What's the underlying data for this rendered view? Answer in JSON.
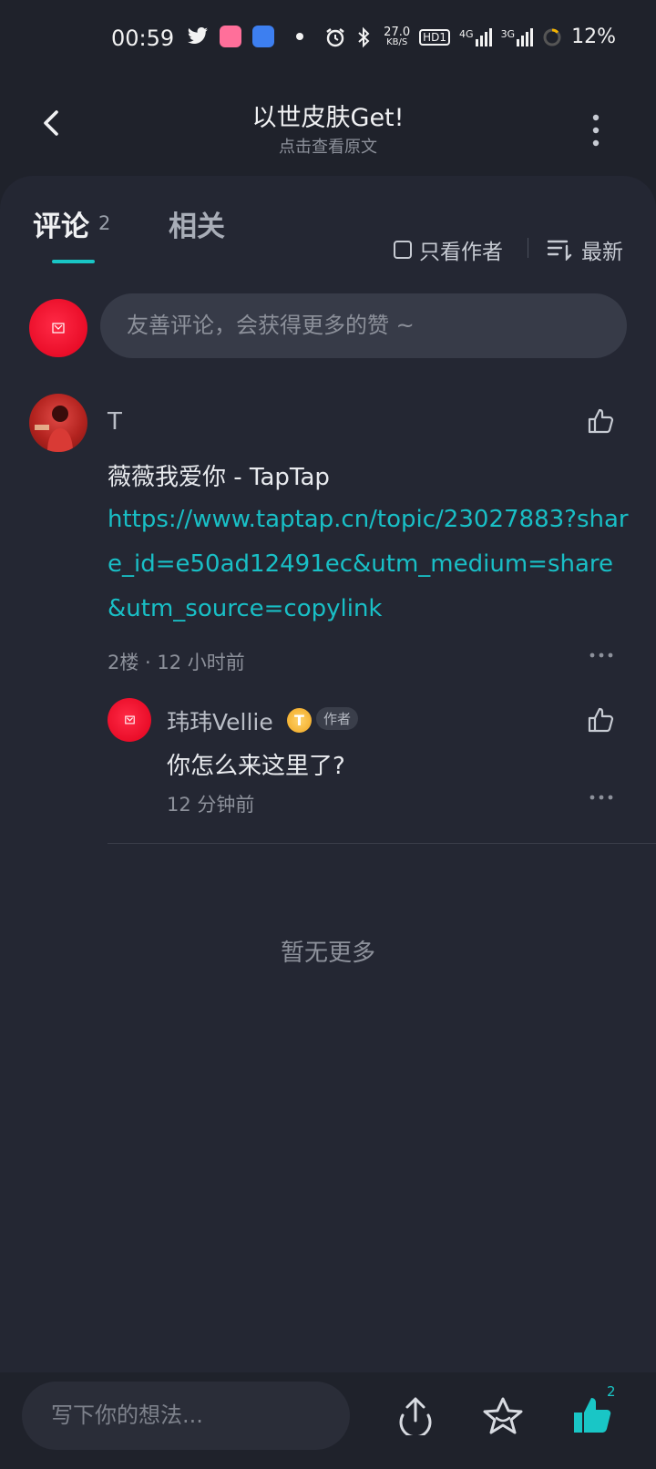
{
  "status_bar": {
    "time": "00:59",
    "net_speed_value": "27.0",
    "net_speed_unit": "KB/S",
    "hd": "HD1",
    "net1": "4G",
    "net2": "3G",
    "battery": "12%"
  },
  "header": {
    "title": "以世皮肤Get!",
    "subtitle": "点击查看原文"
  },
  "tabs": {
    "comments_label": "评论",
    "comments_count": "2",
    "related_label": "相关",
    "author_only_label": "只看作者",
    "sort_label": "最新"
  },
  "composer": {
    "placeholder": "友善评论，会获得更多的赞 ~"
  },
  "comment": {
    "author": "T",
    "text": "薇薇我爱你 - TapTap",
    "link": "https://www.taptap.cn/topic/23027883?share_id=e50ad12491ec&utm_medium=share&utm_source=copylink",
    "floor": "2楼",
    "time": "12 小时前"
  },
  "reply": {
    "author": "玮玮Vellie",
    "badge_letter": "T",
    "author_tag": "作者",
    "text": "你怎么来这里了?",
    "time": "12 分钟前"
  },
  "footer_note": "暂无更多",
  "bottom_bar": {
    "input_placeholder": "写下你的想法...",
    "like_count": "2"
  },
  "colors": {
    "background": "#1f222b",
    "sheet": "#242733",
    "accent": "#19c6c6",
    "avatar_red": "#ff1a35"
  }
}
